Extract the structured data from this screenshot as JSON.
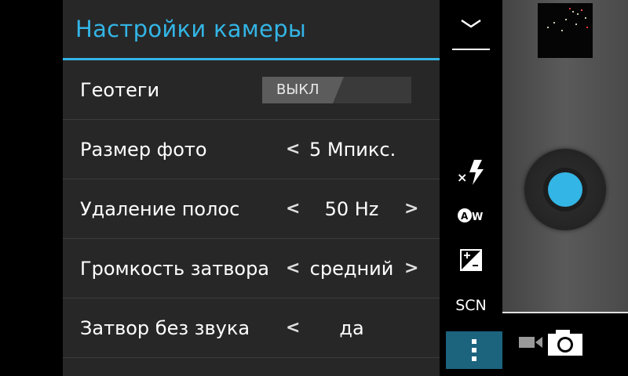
{
  "settings": {
    "title": "Настройки камеры",
    "rows": [
      {
        "label": "Геотеги",
        "value": "ВЫКЛ",
        "type": "toggle",
        "enabled": false
      },
      {
        "label": "Размер фото",
        "value": "5 Мпикс.",
        "left_arrow": "<",
        "right_arrow": ""
      },
      {
        "label": "Удаление полос",
        "value": "50 Hz",
        "left_arrow": "<",
        "right_arrow": ">"
      },
      {
        "label": "Громкость затвора",
        "value": "средний",
        "left_arrow": "<",
        "right_arrow": ">"
      },
      {
        "label": "Затвор без звука",
        "value": "да",
        "left_arrow": "<",
        "right_arrow": ""
      }
    ]
  },
  "strip": {
    "icons": [
      "chevron-down-icon",
      "flash-off-icon",
      "auto-white-balance-icon",
      "exposure-icon",
      "scene-mode-icon",
      "menu-icon"
    ],
    "scene_label": "SCN"
  },
  "camera": {
    "mode_icons": [
      "video-icon",
      "camera-icon"
    ]
  },
  "colors": {
    "accent": "#33b5e5",
    "panel_bg": "#272727",
    "text": "#ffffff"
  }
}
